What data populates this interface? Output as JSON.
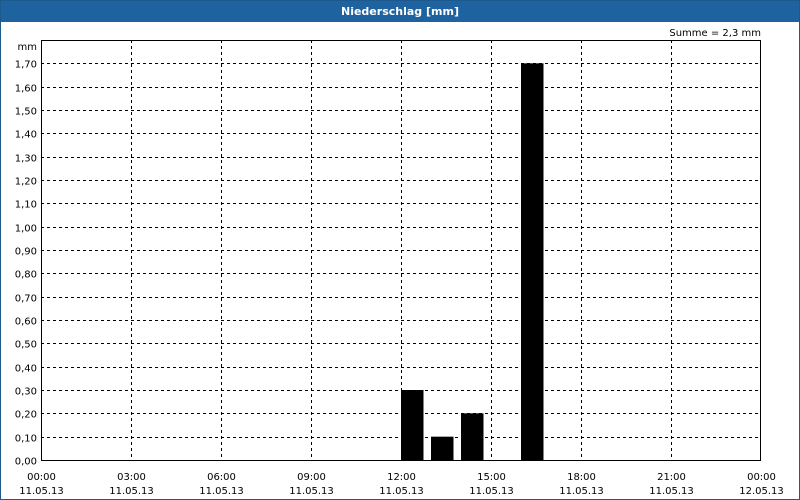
{
  "window": {
    "title": "Niederschlag [mm]"
  },
  "summary": {
    "text": "Summe = 2,3 mm"
  },
  "chart_data": {
    "type": "bar",
    "title": "Niederschlag [mm]",
    "ylabel": "mm",
    "xlabel": "",
    "ylim": [
      0,
      1.8
    ],
    "xlim_hours": [
      0,
      24
    ],
    "grid": true,
    "grid_style": "dashed",
    "bar_color": "#000000",
    "y_ticks": [
      "0,00",
      "0,10",
      "0,20",
      "0,30",
      "0,40",
      "0,50",
      "0,60",
      "0,70",
      "0,80",
      "0,90",
      "1,00",
      "1,10",
      "1,20",
      "1,30",
      "1,40",
      "1,50",
      "1,60",
      "1,70"
    ],
    "x_ticks": [
      {
        "time": "00:00",
        "date": "11.05.13"
      },
      {
        "time": "03:00",
        "date": "11.05.13"
      },
      {
        "time": "06:00",
        "date": "11.05.13"
      },
      {
        "time": "09:00",
        "date": "11.05.13"
      },
      {
        "time": "12:00",
        "date": "11.05.13"
      },
      {
        "time": "15:00",
        "date": "11.05.13"
      },
      {
        "time": "18:00",
        "date": "11.05.13"
      },
      {
        "time": "21:00",
        "date": "11.05.13"
      },
      {
        "time": "00:00",
        "date": "12.05.13"
      }
    ],
    "bars": [
      {
        "start": "12:00",
        "end": "12:45",
        "value": 0.3
      },
      {
        "start": "13:00",
        "end": "13:45",
        "value": 0.1
      },
      {
        "start": "14:00",
        "end": "14:45",
        "value": 0.2
      },
      {
        "start": "16:00",
        "end": "16:45",
        "value": 1.7
      }
    ],
    "sum": "2,3 mm"
  }
}
